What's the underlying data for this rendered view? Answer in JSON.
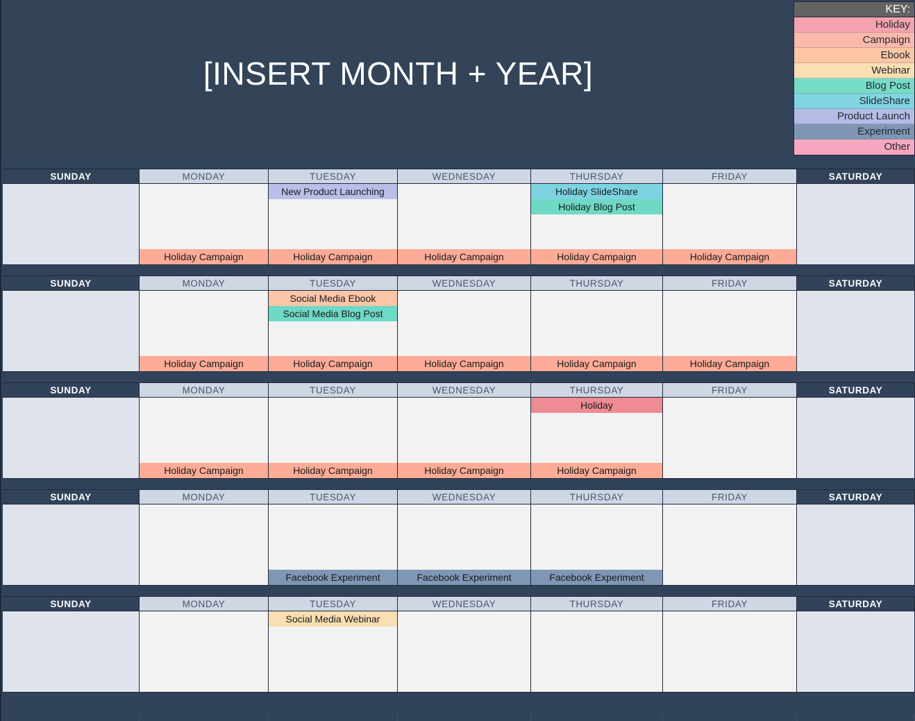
{
  "header": {
    "title": "[INSERT MONTH + YEAR]"
  },
  "key": {
    "heading": "KEY:",
    "items": [
      {
        "label": "Holiday",
        "color": "#f4a3ae"
      },
      {
        "label": "Campaign",
        "color": "#fcb9ab"
      },
      {
        "label": "Ebook",
        "color": "#fcc6a4"
      },
      {
        "label": "Webinar",
        "color": "#fadfb2"
      },
      {
        "label": "Blog Post",
        "color": "#77dcc6"
      },
      {
        "label": "SlideShare",
        "color": "#82d4e3"
      },
      {
        "label": "Product Launch",
        "color": "#b4bbe4"
      },
      {
        "label": "Experiment",
        "color": "#7f97b5"
      },
      {
        "label": "Other",
        "color": "#f7a8c0"
      }
    ]
  },
  "day_names": [
    "SUNDAY",
    "MONDAY",
    "TUESDAY",
    "WEDNESDAY",
    "THURSDAY",
    "FRIDAY",
    "SATURDAY"
  ],
  "event_colors": {
    "holiday": "#ef8b93",
    "campaign": "#fcab96",
    "ebook": "#fbc5a8",
    "webinar": "#fadfb2",
    "blog_post": "#6ed9c4",
    "slideshare": "#7dd3e2",
    "product_launch": "#b9bfe8",
    "experiment": "#7f97b5",
    "other": "#f7a8c0"
  },
  "weeks": [
    {
      "days": [
        {
          "name": "SUNDAY",
          "weekend": true,
          "top_events": [],
          "bottom_events": []
        },
        {
          "name": "MONDAY",
          "weekend": false,
          "top_events": [],
          "bottom_events": [
            {
              "label": "Holiday Campaign",
              "type": "campaign"
            }
          ]
        },
        {
          "name": "TUESDAY",
          "weekend": false,
          "top_events": [
            {
              "label": "New Product Launching",
              "type": "product_launch"
            }
          ],
          "bottom_events": [
            {
              "label": "Holiday Campaign",
              "type": "campaign"
            }
          ]
        },
        {
          "name": "WEDNESDAY",
          "weekend": false,
          "top_events": [],
          "bottom_events": [
            {
              "label": "Holiday Campaign",
              "type": "campaign"
            }
          ]
        },
        {
          "name": "THURSDAY",
          "weekend": false,
          "top_events": [
            {
              "label": "Holiday SlideShare",
              "type": "slideshare"
            },
            {
              "label": "Holiday Blog Post",
              "type": "blog_post"
            }
          ],
          "bottom_events": [
            {
              "label": "Holiday Campaign",
              "type": "campaign"
            }
          ]
        },
        {
          "name": "FRIDAY",
          "weekend": false,
          "top_events": [],
          "bottom_events": [
            {
              "label": "Holiday Campaign",
              "type": "campaign"
            }
          ]
        },
        {
          "name": "SATURDAY",
          "weekend": true,
          "top_events": [],
          "bottom_events": []
        }
      ]
    },
    {
      "days": [
        {
          "name": "SUNDAY",
          "weekend": true,
          "top_events": [],
          "bottom_events": []
        },
        {
          "name": "MONDAY",
          "weekend": false,
          "top_events": [],
          "bottom_events": [
            {
              "label": "Holiday Campaign",
              "type": "campaign"
            }
          ]
        },
        {
          "name": "TUESDAY",
          "weekend": false,
          "top_events": [
            {
              "label": "Social Media Ebook",
              "type": "ebook"
            },
            {
              "label": "Social Media Blog Post",
              "type": "blog_post"
            }
          ],
          "bottom_events": [
            {
              "label": "Holiday Campaign",
              "type": "campaign"
            }
          ]
        },
        {
          "name": "WEDNESDAY",
          "weekend": false,
          "top_events": [],
          "bottom_events": [
            {
              "label": "Holiday Campaign",
              "type": "campaign"
            }
          ]
        },
        {
          "name": "THURSDAY",
          "weekend": false,
          "top_events": [],
          "bottom_events": [
            {
              "label": "Holiday Campaign",
              "type": "campaign"
            }
          ]
        },
        {
          "name": "FRIDAY",
          "weekend": false,
          "top_events": [],
          "bottom_events": [
            {
              "label": "Holiday Campaign",
              "type": "campaign"
            }
          ]
        },
        {
          "name": "SATURDAY",
          "weekend": true,
          "top_events": [],
          "bottom_events": []
        }
      ]
    },
    {
      "days": [
        {
          "name": "SUNDAY",
          "weekend": true,
          "top_events": [],
          "bottom_events": []
        },
        {
          "name": "MONDAY",
          "weekend": false,
          "top_events": [],
          "bottom_events": [
            {
              "label": "Holiday Campaign",
              "type": "campaign"
            }
          ]
        },
        {
          "name": "TUESDAY",
          "weekend": false,
          "top_events": [],
          "bottom_events": [
            {
              "label": "Holiday Campaign",
              "type": "campaign"
            }
          ]
        },
        {
          "name": "WEDNESDAY",
          "weekend": false,
          "top_events": [],
          "bottom_events": [
            {
              "label": "Holiday Campaign",
              "type": "campaign"
            }
          ]
        },
        {
          "name": "THURSDAY",
          "weekend": false,
          "top_events": [
            {
              "label": "Holiday",
              "type": "holiday"
            }
          ],
          "bottom_events": [
            {
              "label": "Holiday Campaign",
              "type": "campaign"
            }
          ]
        },
        {
          "name": "FRIDAY",
          "weekend": false,
          "top_events": [],
          "bottom_events": []
        },
        {
          "name": "SATURDAY",
          "weekend": true,
          "top_events": [],
          "bottom_events": []
        }
      ]
    },
    {
      "days": [
        {
          "name": "SUNDAY",
          "weekend": true,
          "top_events": [],
          "bottom_events": []
        },
        {
          "name": "MONDAY",
          "weekend": false,
          "top_events": [],
          "bottom_events": []
        },
        {
          "name": "TUESDAY",
          "weekend": false,
          "top_events": [],
          "bottom_events": [
            {
              "label": "Facebook Experiment",
              "type": "experiment"
            }
          ]
        },
        {
          "name": "WEDNESDAY",
          "weekend": false,
          "top_events": [],
          "bottom_events": [
            {
              "label": "Facebook Experiment",
              "type": "experiment"
            }
          ]
        },
        {
          "name": "THURSDAY",
          "weekend": false,
          "top_events": [],
          "bottom_events": [
            {
              "label": "Facebook Experiment",
              "type": "experiment"
            }
          ]
        },
        {
          "name": "FRIDAY",
          "weekend": false,
          "top_events": [],
          "bottom_events": []
        },
        {
          "name": "SATURDAY",
          "weekend": true,
          "top_events": [],
          "bottom_events": []
        }
      ]
    },
    {
      "days": [
        {
          "name": "SUNDAY",
          "weekend": true,
          "top_events": [],
          "bottom_events": []
        },
        {
          "name": "MONDAY",
          "weekend": false,
          "top_events": [],
          "bottom_events": []
        },
        {
          "name": "TUESDAY",
          "weekend": false,
          "top_events": [
            {
              "label": "Social Media Webinar",
              "type": "webinar"
            }
          ],
          "bottom_events": []
        },
        {
          "name": "WEDNESDAY",
          "weekend": false,
          "top_events": [],
          "bottom_events": []
        },
        {
          "name": "THURSDAY",
          "weekend": false,
          "top_events": [],
          "bottom_events": []
        },
        {
          "name": "FRIDAY",
          "weekend": false,
          "top_events": [],
          "bottom_events": []
        },
        {
          "name": "SATURDAY",
          "weekend": true,
          "top_events": [],
          "bottom_events": []
        }
      ]
    }
  ]
}
